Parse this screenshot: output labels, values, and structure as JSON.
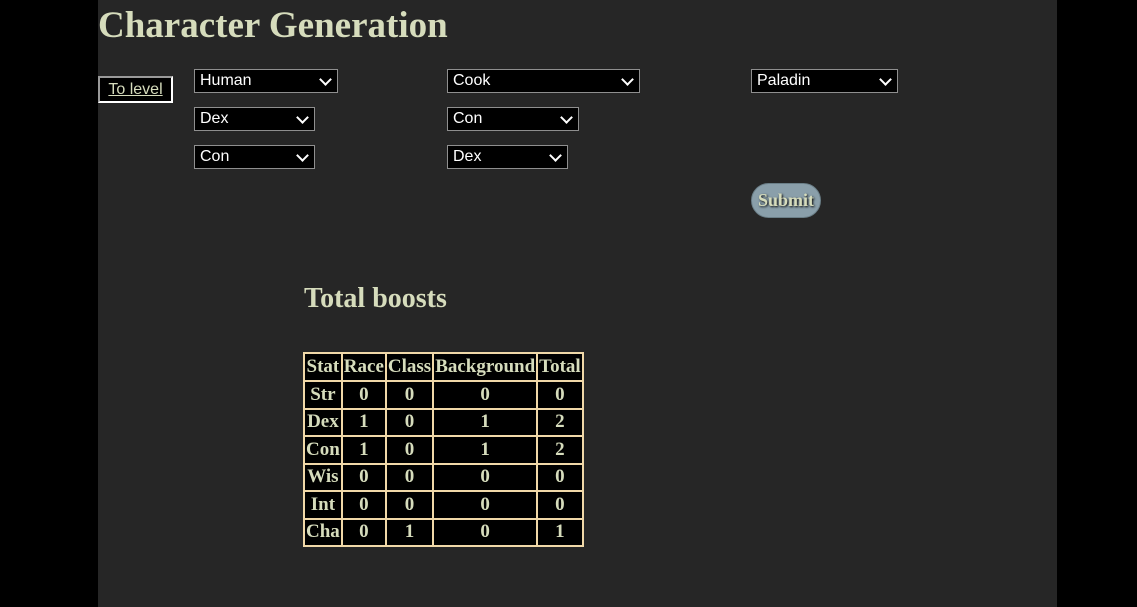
{
  "header": {
    "title": "Character Generation"
  },
  "controls": {
    "to_level_label": "To level",
    "race": "Human",
    "background": "Cook",
    "class": "Paladin",
    "race_boost_1": "Dex",
    "race_boost_2": "Con",
    "background_boost_1": "Con",
    "background_boost_2": "Dex",
    "submit_label": "Submit"
  },
  "boosts": {
    "title": "Total boosts",
    "headers": [
      "Stat",
      "Race",
      "Class",
      "Background",
      "Total"
    ],
    "rows": [
      [
        "Str",
        "0",
        "0",
        "0",
        "0"
      ],
      [
        "Dex",
        "1",
        "0",
        "1",
        "2"
      ],
      [
        "Con",
        "1",
        "0",
        "1",
        "2"
      ],
      [
        "Wis",
        "0",
        "0",
        "0",
        "0"
      ],
      [
        "Int",
        "0",
        "0",
        "0",
        "0"
      ],
      [
        "Cha",
        "0",
        "1",
        "0",
        "1"
      ]
    ]
  },
  "colors": {
    "page_background": "#262626",
    "outer_background": "#000000",
    "text": "#d6dcbc",
    "table_border": "#f0d8a8",
    "submit_background": "#8a9faa"
  }
}
